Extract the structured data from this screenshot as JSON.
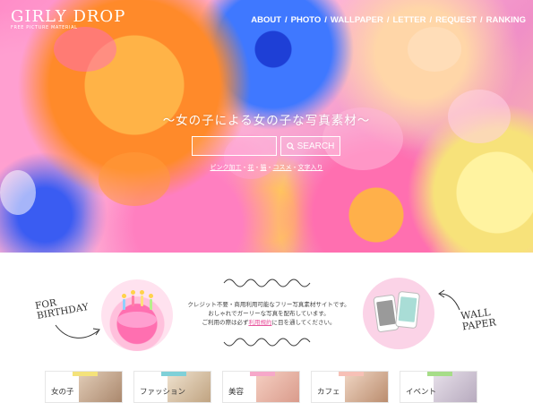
{
  "logo": {
    "title": "GIRLY DROP",
    "subtitle": "FREE PICTURE MATERIAL"
  },
  "nav": {
    "items": [
      "ABOUT",
      "PHOTO",
      "WALLPAPER",
      "LETTER",
      "REQUEST",
      "RANKING"
    ],
    "separator": "/"
  },
  "hero": {
    "tagline": "〜女の子による女の子な写真素材〜",
    "search": {
      "value": "",
      "placeholder": "",
      "button_label": "SEARCH"
    },
    "tags": [
      "ピンク加工",
      "花",
      "猫",
      "コスメ",
      "文字入り"
    ],
    "tag_separator": "・"
  },
  "intro": {
    "left_label_line1": "FOR",
    "left_label_line2": "BIRTHDAY",
    "right_label_line1": "WALL",
    "right_label_line2": "PAPER",
    "text_line1": "クレジット不要・商用利用可能なフリー写真素材サイトです。",
    "text_line2": "おしゃれでガーリーな写真を配布しています。",
    "text_line3_prefix": "ご利用の際は必ず",
    "text_line3_link": "利用規約",
    "text_line3_suffix": "に目を通してください。"
  },
  "categories": [
    {
      "label": "女の子",
      "tape_color": "#f4e27a",
      "thumb_color": "#c9a88a"
    },
    {
      "label": "ファッション",
      "tape_color": "#7fd0d8",
      "thumb_color": "#d6c2a8"
    },
    {
      "label": "美容",
      "tape_color": "#f6a8c9",
      "thumb_color": "#e9b2a0"
    },
    {
      "label": "カフェ",
      "tape_color": "#f7c0b6",
      "thumb_color": "#cfa487"
    },
    {
      "label": "イベント",
      "tape_color": "#a6dd88",
      "thumb_color": "#d0c7d6"
    }
  ],
  "colors": {
    "accent_pink": "#e8569e"
  }
}
